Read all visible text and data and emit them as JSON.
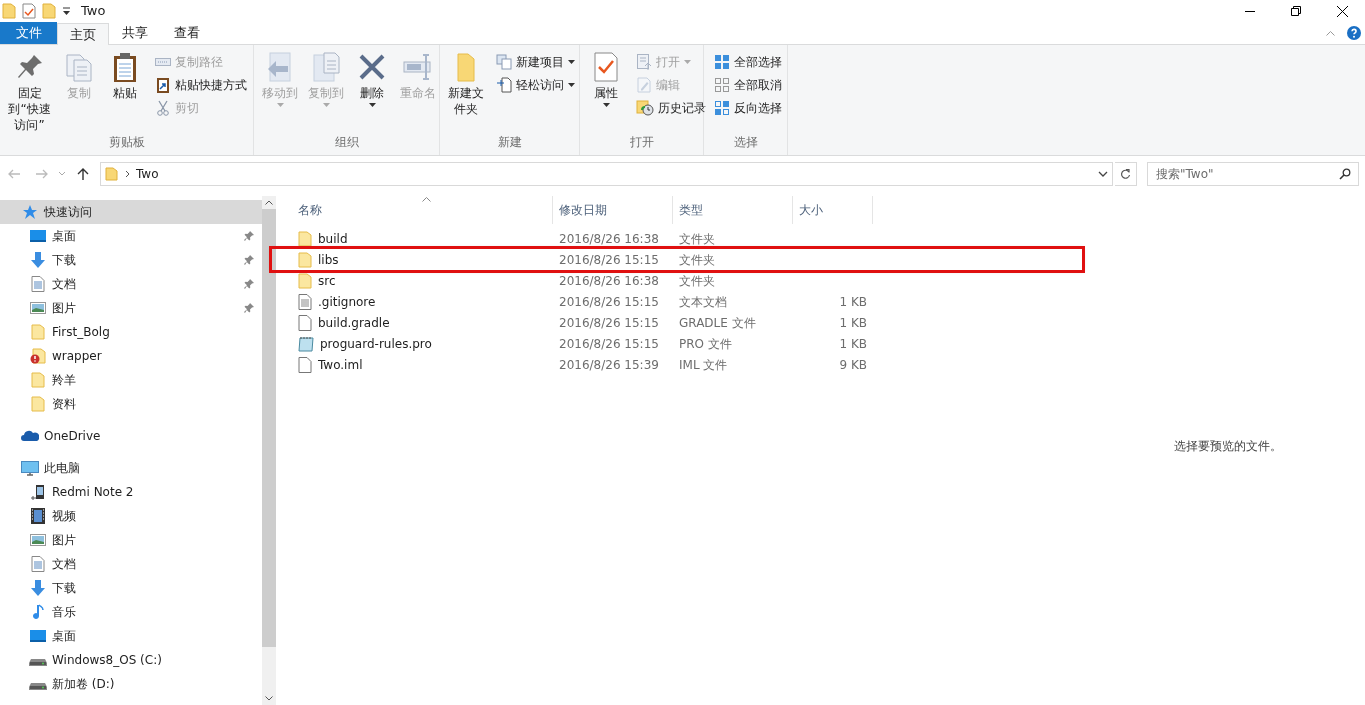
{
  "window": {
    "title": "Two"
  },
  "ribbon_tabs": [
    {
      "label": "文件",
      "kind": "file",
      "selected": false
    },
    {
      "label": "主页",
      "kind": "tab",
      "selected": true
    },
    {
      "label": "共享",
      "kind": "tab",
      "selected": false
    },
    {
      "label": "查看",
      "kind": "tab",
      "selected": false
    }
  ],
  "ribbon_groups": [
    {
      "label": "剪贴板",
      "items": [
        {
          "label": "固定到“快速访问”",
          "kind": "large",
          "disabled": false,
          "dropdown": false
        },
        {
          "label": "复制",
          "kind": "large",
          "disabled": true,
          "dropdown": false
        },
        {
          "label": "粘贴",
          "kind": "large",
          "disabled": false,
          "dropdown": false
        },
        {
          "label": "复制路径",
          "kind": "small",
          "disabled": true,
          "dropdown": false
        },
        {
          "label": "粘贴快捷方式",
          "kind": "small",
          "disabled": false,
          "dropdown": false
        },
        {
          "label": "剪切",
          "kind": "small",
          "disabled": true,
          "dropdown": false
        }
      ]
    },
    {
      "label": "组织",
      "items": [
        {
          "label": "移动到",
          "kind": "large",
          "disabled": true,
          "dropdown": true
        },
        {
          "label": "复制到",
          "kind": "large",
          "disabled": true,
          "dropdown": true
        },
        {
          "label": "删除",
          "kind": "large",
          "disabled": false,
          "dropdown": true
        },
        {
          "label": "重命名",
          "kind": "large",
          "disabled": true,
          "dropdown": false
        }
      ]
    },
    {
      "label": "新建",
      "items": [
        {
          "label": "新建文件夹",
          "kind": "large",
          "disabled": false,
          "dropdown": false
        },
        {
          "label": "新建项目",
          "kind": "small",
          "disabled": false,
          "dropdown": true
        },
        {
          "label": "轻松访问",
          "kind": "small",
          "disabled": false,
          "dropdown": true
        }
      ]
    },
    {
      "label": "打开",
      "items": [
        {
          "label": "属性",
          "kind": "large",
          "disabled": false,
          "dropdown": true
        },
        {
          "label": "打开",
          "kind": "small",
          "disabled": true,
          "dropdown": true
        },
        {
          "label": "编辑",
          "kind": "small",
          "disabled": true,
          "dropdown": false
        },
        {
          "label": "历史记录",
          "kind": "small",
          "disabled": false,
          "dropdown": false
        }
      ]
    },
    {
      "label": "选择",
      "items": [
        {
          "label": "全部选择",
          "kind": "small",
          "disabled": false,
          "dropdown": false
        },
        {
          "label": "全部取消",
          "kind": "small",
          "disabled": false,
          "dropdown": false
        },
        {
          "label": "反向选择",
          "kind": "small",
          "disabled": false,
          "dropdown": false
        }
      ]
    }
  ],
  "address_bar": {
    "path": [
      "Two"
    ]
  },
  "search": {
    "placeholder": "搜索\"Two\""
  },
  "sidebar": {
    "items": [
      {
        "label": "快速访问",
        "kind": "star",
        "selected": true,
        "children": [
          {
            "label": "桌面",
            "kind": "desktop",
            "pinned": true,
            "selected": false
          },
          {
            "label": "下载",
            "kind": "download",
            "pinned": true,
            "selected": false
          },
          {
            "label": "文档",
            "kind": "document",
            "pinned": true,
            "selected": false
          },
          {
            "label": "图片",
            "kind": "pictures",
            "pinned": true,
            "selected": false
          },
          {
            "label": "First_Bolg",
            "kind": "folder",
            "pinned": false,
            "selected": false
          },
          {
            "label": "wrapper",
            "kind": "warning-folder",
            "pinned": false,
            "selected": false
          },
          {
            "label": "羚羊",
            "kind": "folder",
            "pinned": false,
            "selected": false
          },
          {
            "label": "资料",
            "kind": "folder",
            "pinned": false,
            "selected": false
          }
        ]
      },
      {
        "label": "OneDrive",
        "kind": "cloud",
        "selected": false
      },
      {
        "label": "此电脑",
        "kind": "computer",
        "selected": false,
        "children": [
          {
            "label": "Redmi Note 2",
            "kind": "phone",
            "pinned": false,
            "selected": false
          },
          {
            "label": "视频",
            "kind": "video",
            "pinned": false,
            "selected": false
          },
          {
            "label": "图片",
            "kind": "pictures",
            "pinned": false,
            "selected": false
          },
          {
            "label": "文档",
            "kind": "document",
            "pinned": false,
            "selected": false
          },
          {
            "label": "下载",
            "kind": "download",
            "pinned": false,
            "selected": false
          },
          {
            "label": "音乐",
            "kind": "music",
            "pinned": false,
            "selected": false
          },
          {
            "label": "桌面",
            "kind": "desktop",
            "pinned": false,
            "selected": false
          },
          {
            "label": "Windows8_OS (C:)",
            "kind": "drive",
            "pinned": false,
            "selected": false
          },
          {
            "label": "新加卷 (D:)",
            "kind": "drive",
            "pinned": false,
            "selected": false
          }
        ]
      }
    ]
  },
  "file_list": {
    "columns": [
      {
        "label": "名称",
        "sorted": true
      },
      {
        "label": "修改日期",
        "sorted": false
      },
      {
        "label": "类型",
        "sorted": false
      },
      {
        "label": "大小",
        "sorted": false
      }
    ],
    "rows": [
      {
        "kind": "folder",
        "name": "build",
        "date": "2016/8/26 16:38",
        "type": "文件夹",
        "size": "",
        "highlighted": false
      },
      {
        "kind": "folder",
        "name": "libs",
        "date": "2016/8/26 15:15",
        "type": "文件夹",
        "size": "",
        "highlighted": true
      },
      {
        "kind": "folder",
        "name": "src",
        "date": "2016/8/26 16:38",
        "type": "文件夹",
        "size": "",
        "highlighted": false
      },
      {
        "kind": "text",
        "name": ".gitignore",
        "date": "2016/8/26 15:15",
        "type": "文本文档",
        "size": "1 KB",
        "highlighted": false
      },
      {
        "kind": "file",
        "name": "build.gradle",
        "date": "2016/8/26 15:15",
        "type": "GRADLE 文件",
        "size": "1 KB",
        "highlighted": false
      },
      {
        "kind": "notepad",
        "name": "proguard-rules.pro",
        "date": "2016/8/26 15:15",
        "type": "PRO 文件",
        "size": "1 KB",
        "highlighted": false
      },
      {
        "kind": "file",
        "name": "Two.iml",
        "date": "2016/8/26 15:39",
        "type": "IML 文件",
        "size": "9 KB",
        "highlighted": false
      }
    ]
  },
  "preview": {
    "message": "选择要预览的文件。"
  }
}
